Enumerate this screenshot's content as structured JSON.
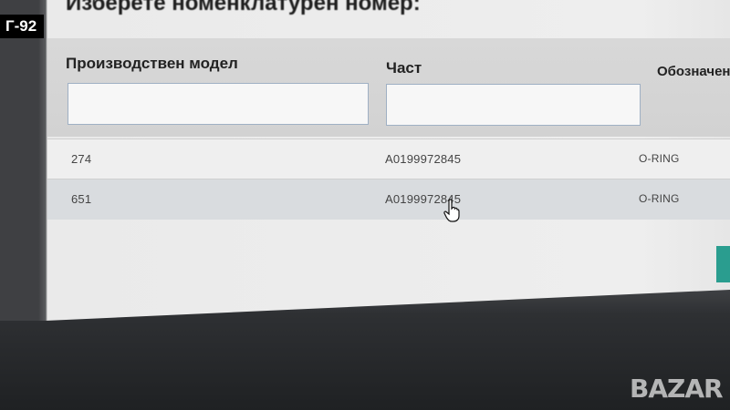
{
  "dialog": {
    "title": "Изберете номенклатурен номер:"
  },
  "columns": {
    "model": "Производствен модел",
    "part": "Част",
    "description": "Обозначен"
  },
  "filters": {
    "model_value": "",
    "part_value": ""
  },
  "rows": [
    {
      "id": "274",
      "part": "A0199972845",
      "description": "O-RING"
    },
    {
      "id": "651",
      "part": "A0199972845",
      "description": "O-RING"
    }
  ],
  "overlay": {
    "tag": "Г-92",
    "watermark": "BAZAR"
  },
  "colors": {
    "accent": "#2a9d8f",
    "input_border": "#9fb0c4"
  }
}
